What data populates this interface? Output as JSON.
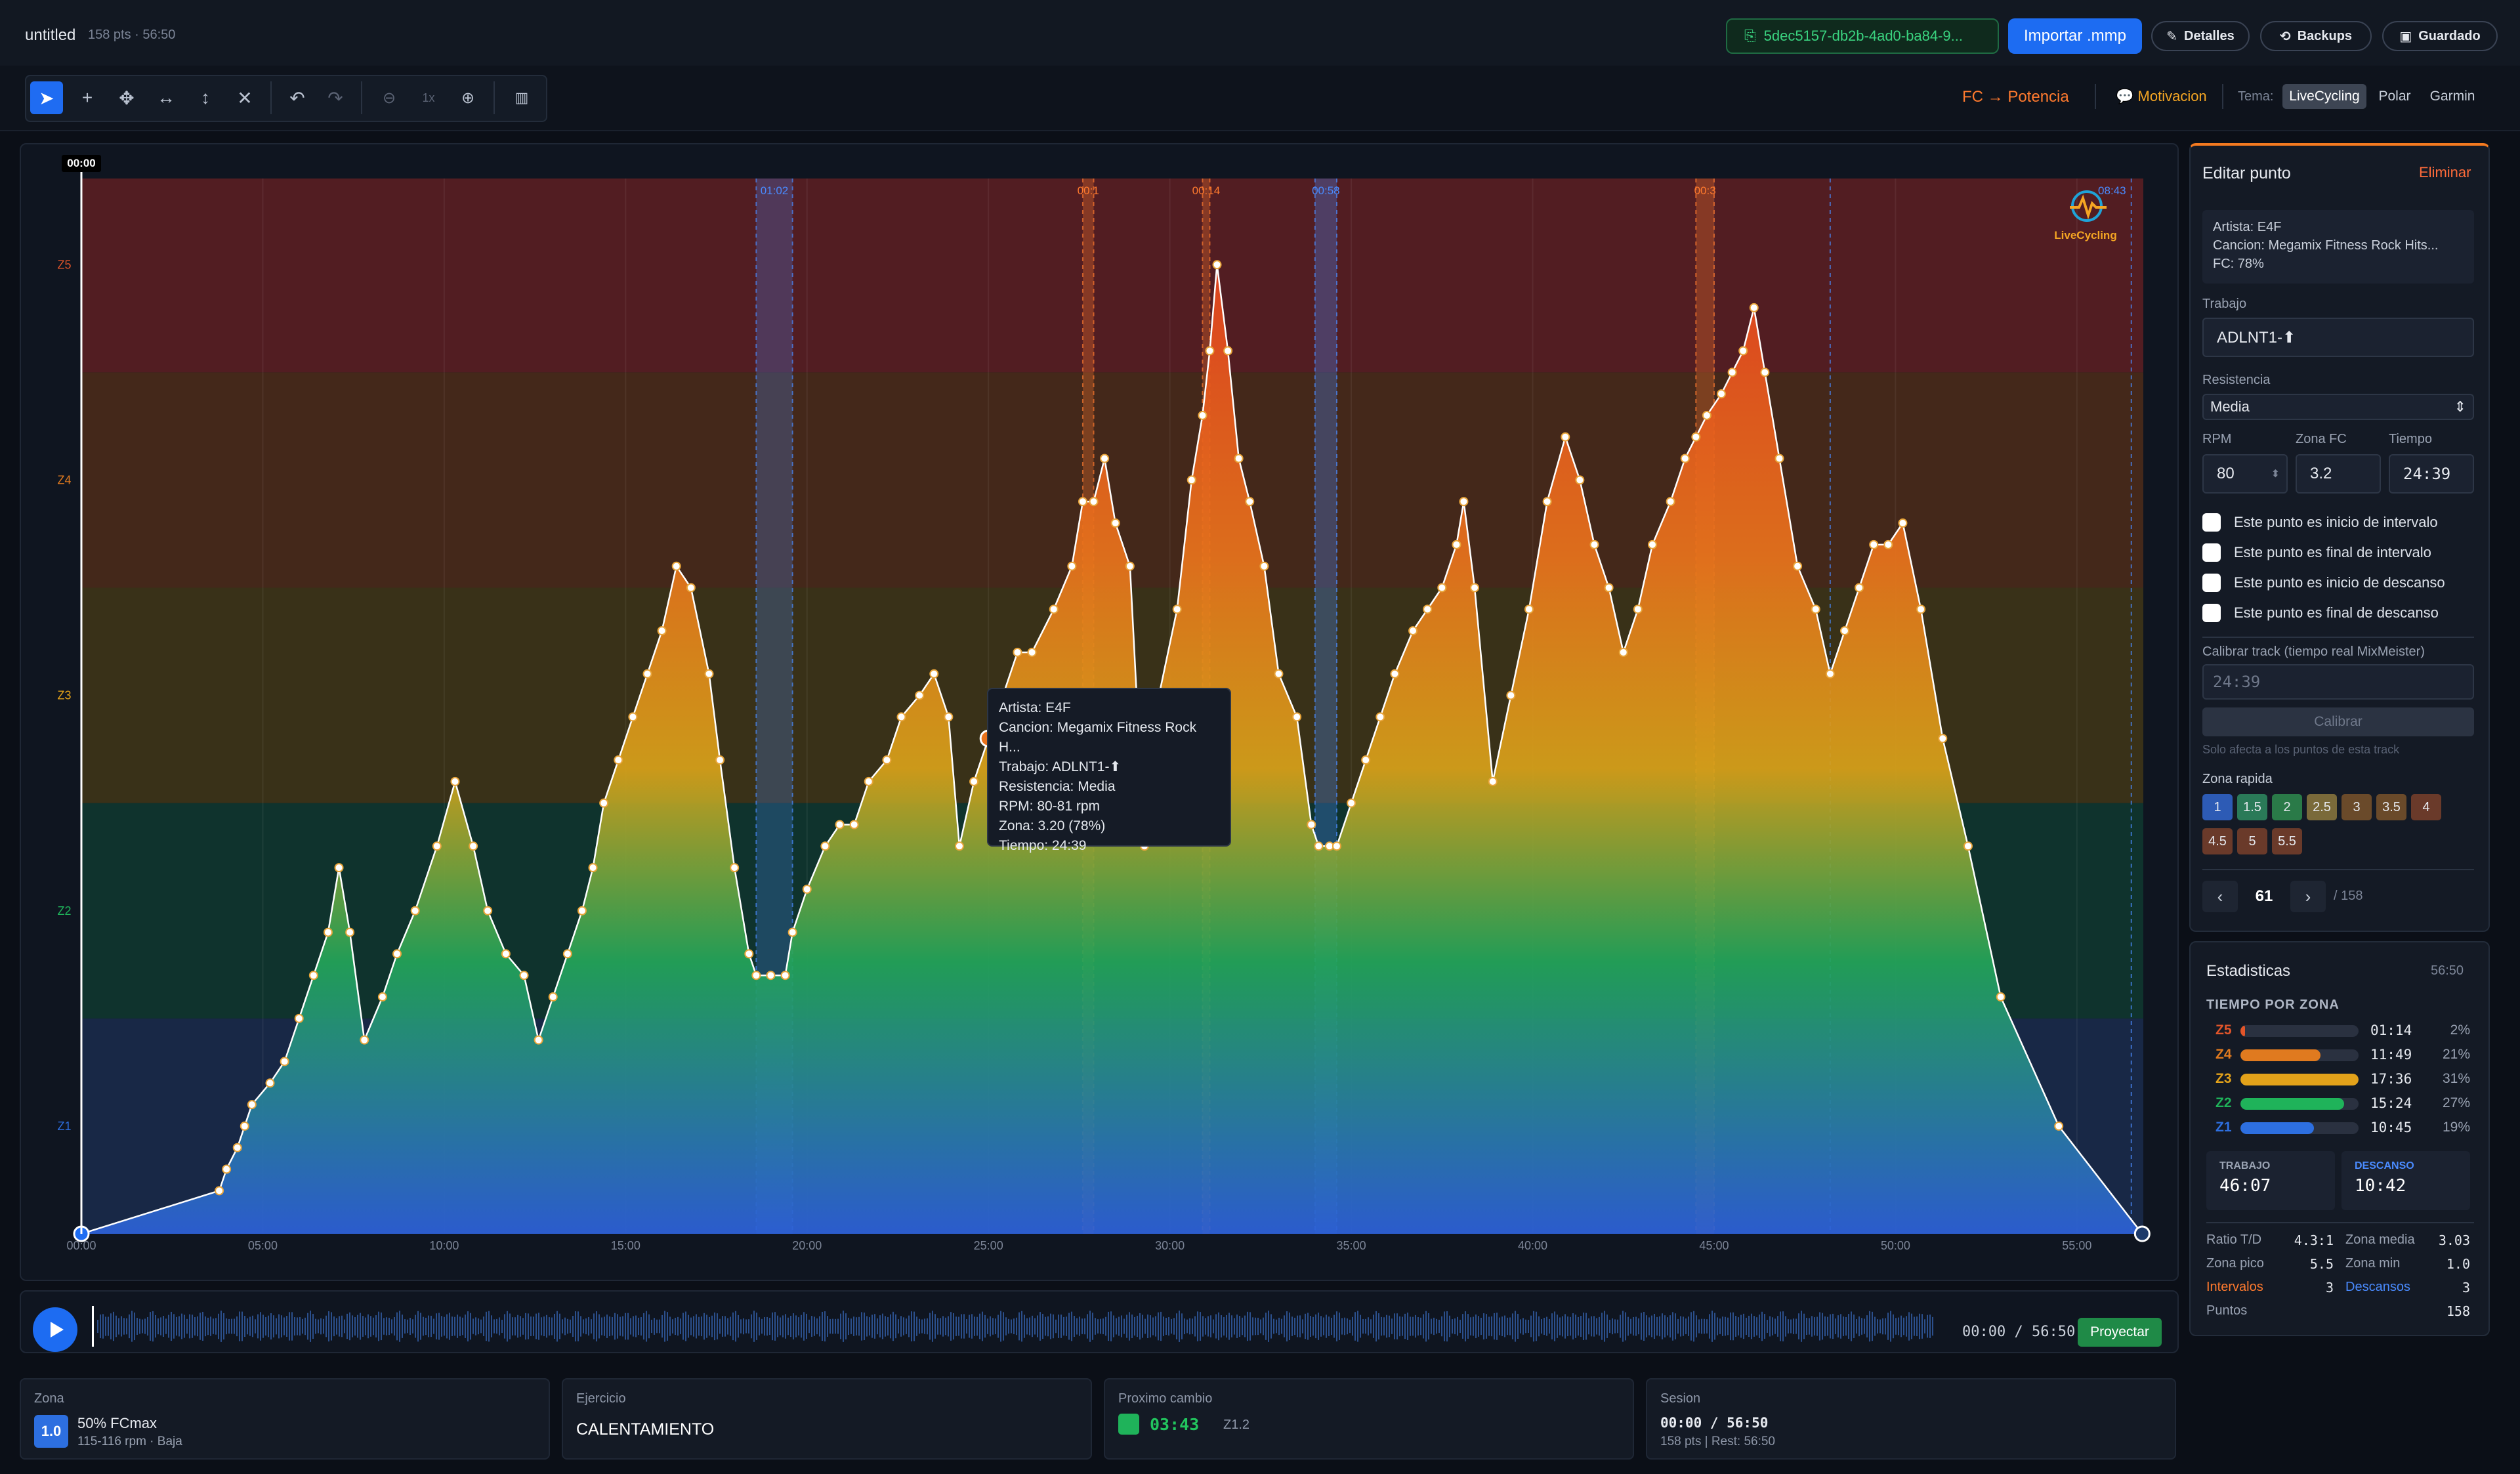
{
  "app": {
    "title": "untitled",
    "subtitle": "158 pts · 56:50"
  },
  "header": {
    "uuid": "5dec5157-db2b-4ad0-ba84-9...",
    "import_label": "Importar .mmp",
    "details_label": "Detalles",
    "backups_label": "Backups",
    "saved_label": "Guardado"
  },
  "toolbar": {
    "zoom_level": "1x",
    "hr_power_label": "FC → Potencia",
    "motivation_label": "Motivacion",
    "theme_label": "Tema:",
    "themes": [
      "LiveCycling",
      "Polar",
      "Garmin"
    ],
    "selected_theme": "LiveCycling"
  },
  "chart": {
    "start_marker": "00:00",
    "brand": "LiveCycling",
    "zone_labels": [
      "Z5",
      "Z4",
      "Z3",
      "Z2",
      "Z1"
    ],
    "x_ticks": [
      "00:00",
      "05:00",
      "10:00",
      "15:00",
      "20:00",
      "25:00",
      "30:00",
      "35:00",
      "40:00",
      "45:00",
      "50:00",
      "55:00"
    ],
    "interval_labels": [
      "01:02",
      "00:1",
      "00:14",
      "00:58",
      "00:3",
      "08:43"
    ],
    "colors": {
      "z5": "#5a1e22",
      "z4": "#4a2a1a",
      "z3": "#3e3417",
      "z2": "#10362f",
      "z1": "#1a2a4a",
      "accent": "#1d6cf2"
    }
  },
  "chart_data": {
    "type": "area",
    "xlabel": "",
    "ylabel": "",
    "x_unit": "min",
    "y_unit": "zone",
    "xlim": [
      0,
      56.83
    ],
    "ylim": [
      0.5,
      5.4
    ],
    "zones": [
      "Z1",
      "Z2",
      "Z3",
      "Z4",
      "Z5"
    ],
    "points": [
      [
        0,
        0.5
      ],
      [
        3.8,
        0.7
      ],
      [
        4.0,
        0.8
      ],
      [
        4.3,
        0.9
      ],
      [
        4.5,
        1.0
      ],
      [
        4.7,
        1.1
      ],
      [
        5.2,
        1.2
      ],
      [
        5.6,
        1.3
      ],
      [
        6.0,
        1.5
      ],
      [
        6.4,
        1.7
      ],
      [
        6.8,
        1.9
      ],
      [
        7.1,
        2.2
      ],
      [
        7.4,
        1.9
      ],
      [
        7.8,
        1.4
      ],
      [
        8.3,
        1.6
      ],
      [
        8.7,
        1.8
      ],
      [
        9.2,
        2.0
      ],
      [
        9.8,
        2.3
      ],
      [
        10.3,
        2.6
      ],
      [
        10.8,
        2.3
      ],
      [
        11.2,
        2.0
      ],
      [
        11.7,
        1.8
      ],
      [
        12.2,
        1.7
      ],
      [
        12.6,
        1.4
      ],
      [
        13.0,
        1.6
      ],
      [
        13.4,
        1.8
      ],
      [
        13.8,
        2.0
      ],
      [
        14.1,
        2.2
      ],
      [
        14.4,
        2.5
      ],
      [
        14.8,
        2.7
      ],
      [
        15.2,
        2.9
      ],
      [
        15.6,
        3.1
      ],
      [
        16.0,
        3.3
      ],
      [
        16.4,
        3.6
      ],
      [
        16.8,
        3.5
      ],
      [
        17.3,
        3.1
      ],
      [
        17.6,
        2.7
      ],
      [
        18.0,
        2.2
      ],
      [
        18.4,
        1.8
      ],
      [
        18.6,
        1.7
      ],
      [
        19.0,
        1.7
      ],
      [
        19.4,
        1.7
      ],
      [
        19.6,
        1.9
      ],
      [
        20.0,
        2.1
      ],
      [
        20.5,
        2.3
      ],
      [
        20.9,
        2.4
      ],
      [
        21.3,
        2.4
      ],
      [
        21.7,
        2.6
      ],
      [
        22.2,
        2.7
      ],
      [
        22.6,
        2.9
      ],
      [
        23.1,
        3.0
      ],
      [
        23.5,
        3.1
      ],
      [
        23.9,
        2.9
      ],
      [
        24.2,
        2.3
      ],
      [
        24.6,
        2.6
      ],
      [
        25.0,
        2.8
      ],
      [
        25.4,
        3.0
      ],
      [
        25.8,
        3.2
      ],
      [
        26.2,
        3.2
      ],
      [
        26.8,
        3.4
      ],
      [
        27.3,
        3.6
      ],
      [
        27.6,
        3.9
      ],
      [
        27.9,
        3.9
      ],
      [
        28.2,
        4.1
      ],
      [
        28.5,
        3.8
      ],
      [
        28.9,
        3.6
      ],
      [
        29.3,
        2.3
      ],
      [
        29.7,
        3.0
      ],
      [
        30.2,
        3.4
      ],
      [
        30.6,
        4.0
      ],
      [
        30.9,
        4.3
      ],
      [
        31.1,
        4.6
      ],
      [
        31.3,
        5.0
      ],
      [
        31.6,
        4.6
      ],
      [
        31.9,
        4.1
      ],
      [
        32.2,
        3.9
      ],
      [
        32.6,
        3.6
      ],
      [
        33.0,
        3.1
      ],
      [
        33.5,
        2.9
      ],
      [
        33.9,
        2.4
      ],
      [
        34.1,
        2.3
      ],
      [
        34.4,
        2.3
      ],
      [
        34.6,
        2.3
      ],
      [
        35.0,
        2.5
      ],
      [
        35.4,
        2.7
      ],
      [
        35.8,
        2.9
      ],
      [
        36.2,
        3.1
      ],
      [
        36.7,
        3.3
      ],
      [
        37.1,
        3.4
      ],
      [
        37.5,
        3.5
      ],
      [
        37.9,
        3.7
      ],
      [
        38.1,
        3.9
      ],
      [
        38.4,
        3.5
      ],
      [
        38.9,
        2.6
      ],
      [
        39.4,
        3.0
      ],
      [
        39.9,
        3.4
      ],
      [
        40.4,
        3.9
      ],
      [
        40.9,
        4.2
      ],
      [
        41.3,
        4.0
      ],
      [
        41.7,
        3.7
      ],
      [
        42.1,
        3.5
      ],
      [
        42.5,
        3.2
      ],
      [
        42.9,
        3.4
      ],
      [
        43.3,
        3.7
      ],
      [
        43.8,
        3.9
      ],
      [
        44.2,
        4.1
      ],
      [
        44.5,
        4.2
      ],
      [
        44.8,
        4.3
      ],
      [
        45.2,
        4.4
      ],
      [
        45.5,
        4.5
      ],
      [
        45.8,
        4.6
      ],
      [
        46.1,
        4.8
      ],
      [
        46.4,
        4.5
      ],
      [
        46.8,
        4.1
      ],
      [
        47.3,
        3.6
      ],
      [
        47.8,
        3.4
      ],
      [
        48.2,
        3.1
      ],
      [
        48.6,
        3.3
      ],
      [
        49.0,
        3.5
      ],
      [
        49.4,
        3.7
      ],
      [
        49.8,
        3.7
      ],
      [
        50.2,
        3.8
      ],
      [
        50.7,
        3.4
      ],
      [
        51.3,
        2.8
      ],
      [
        52.0,
        2.3
      ],
      [
        52.9,
        1.6
      ],
      [
        54.5,
        1.0
      ],
      [
        56.8,
        0.5
      ]
    ],
    "selected_point_index": 61,
    "selected_point": [
      25.0,
      2.8
    ]
  },
  "tooltip": {
    "lines": [
      "Artista:  E4F",
      "Cancion:  Megamix Fitness Rock H...",
      "Trabajo:  ADLNT1-⬆",
      "Resistencia:  Media",
      "RPM:  80-81 rpm",
      "Zona:  3.20 (78%)",
      "Tiempo:  24:39"
    ]
  },
  "edit": {
    "title": "Editar punto",
    "delete_label": "Eliminar",
    "info": [
      "Artista: E4F",
      "Cancion: Megamix Fitness Rock Hits...",
      "FC: 78%"
    ],
    "work_label": "Trabajo",
    "work_value": "ADLNT1-⬆",
    "resistance_label": "Resistencia",
    "resistance_value": "Media",
    "rpm_label": "RPM",
    "rpm_value": "80",
    "hr_zone_label": "Zona FC",
    "hr_zone_value": "3.2",
    "time_label": "Tiempo",
    "time_value": "24:39",
    "checks": [
      "Este punto es inicio de intervalo",
      "Este punto es final de intervalo",
      "Este punto es inicio de descanso",
      "Este punto es final de descanso"
    ],
    "calib_label": "Calibrar track (tiempo real MixMeister)",
    "calib_placeholder": "24:39",
    "calib_btn": "Calibrar",
    "calib_note": "Solo afecta a los puntos de esta track",
    "quick_label": "Zona rapida",
    "quick_zones": [
      "1",
      "1.5",
      "2",
      "2.5",
      "3",
      "3.5",
      "4",
      "4.5",
      "5",
      "5.5"
    ],
    "point_index": "61",
    "point_total": "/ 158"
  },
  "stats": {
    "title": "Estadisticas",
    "total": "56:50",
    "section": "TIEMPO POR ZONA",
    "zones": [
      {
        "label": "Z5",
        "time": "01:14",
        "pct": "2%",
        "fill": 0.04,
        "color": "#e2552a"
      },
      {
        "label": "Z4",
        "time": "11:49",
        "pct": "21%",
        "fill": 0.68,
        "color": "#e07a1f"
      },
      {
        "label": "Z3",
        "time": "17:36",
        "pct": "31%",
        "fill": 1.0,
        "color": "#e3a21a"
      },
      {
        "label": "Z2",
        "time": "15:24",
        "pct": "27%",
        "fill": 0.88,
        "color": "#1fb35a"
      },
      {
        "label": "Z1",
        "time": "10:45",
        "pct": "19%",
        "fill": 0.62,
        "color": "#2d6fe0"
      }
    ],
    "work_label": "TRABAJO",
    "work_value": "46:07",
    "rest_label": "DESCANSO",
    "rest_value": "10:42",
    "ratio_label": "Ratio T/D",
    "ratio_value": "4.3:1",
    "avg_label": "Zona media",
    "avg_value": "3.03",
    "peak_label": "Zona pico",
    "peak_value": "5.5",
    "min_label": "Zona min",
    "min_value": "1.0",
    "intervals_label": "Intervalos",
    "intervals_value": "3",
    "rests_label": "Descansos",
    "rests_value": "3",
    "points_label": "Puntos",
    "points_value": "158"
  },
  "player": {
    "time": "00:00 / 56:50",
    "project_label": "Proyectar"
  },
  "bottom": {
    "zone_label": "Zona",
    "zone_badge": "1.0",
    "zone_main": "50% FCmax",
    "zone_sub": "115-116 rpm · Baja",
    "exercise_label": "Ejercicio",
    "exercise_value": "CALENTAMIENTO",
    "next_label": "Proximo cambio",
    "next_time": "03:43",
    "next_zone": "Z1.2",
    "session_label": "Sesion",
    "session_time": "00:00 / 56:50",
    "session_sub": "158 pts | Rest: 56:50"
  }
}
